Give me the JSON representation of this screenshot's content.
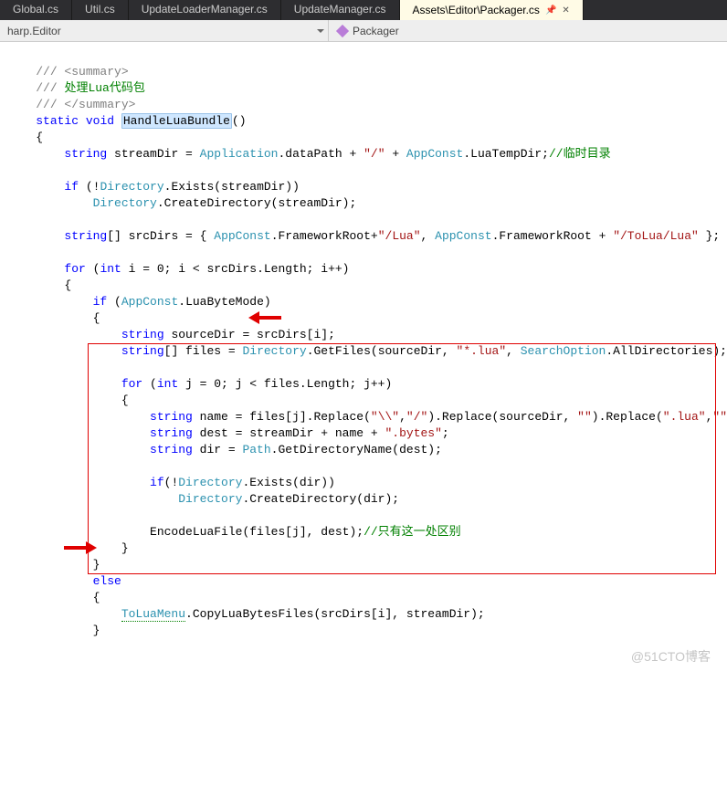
{
  "tabs": {
    "t0": "Global.cs",
    "t1": "Util.cs",
    "t2": "UpdateLoaderManager.cs",
    "t3": "UpdateManager.cs",
    "t4": "Assets\\Editor\\Packager.cs"
  },
  "nav": {
    "left": "harp.Editor",
    "right": "Packager"
  },
  "code": {
    "l1a": "/// <summary>",
    "l2a": "/// ",
    "l2b": "处理Lua代码包",
    "l3a": "/// </summary>",
    "l4a": "static",
    "l4b": "void",
    "l4c": "HandleLuaBundle",
    "l4d": "()",
    "l5a": "{",
    "l6a": "string",
    "l6b": " streamDir = ",
    "l6c": "Application",
    "l6d": ".dataPath + ",
    "l6e": "\"/\"",
    "l6f": " + ",
    "l6g": "AppConst",
    "l6h": ".LuaTempDir;",
    "l6i": "//临时目录",
    "l8a": "if",
    "l8b": " (!",
    "l8c": "Directory",
    "l8d": ".Exists(streamDir))",
    "l9a": "Directory",
    "l9b": ".CreateDirectory(streamDir);",
    "l11a": "string",
    "l11b": "[] srcDirs = { ",
    "l11c": "AppConst",
    "l11d": ".FrameworkRoot+",
    "l11e": "\"/Lua\"",
    "l11f": ", ",
    "l11g": "AppConst",
    "l11h": ".FrameworkRoot + ",
    "l11i": "\"/ToLua/Lua\"",
    "l11j": " };",
    "l13a": "for",
    "l13b": " (",
    "l13c": "int",
    "l13d": " i = 0; i < srcDirs.Length; i++)",
    "l14a": "{",
    "l15a": "if",
    "l15b": " (",
    "l15c": "AppConst",
    "l15d": ".LuaByteMode)",
    "l16a": "{",
    "l17a": "string",
    "l17b": " sourceDir = srcDirs[i];",
    "l18a": "string",
    "l18b": "[] files = ",
    "l18c": "Directory",
    "l18d": ".GetFiles(sourceDir, ",
    "l18e": "\"*.lua\"",
    "l18f": ", ",
    "l18g": "SearchOption",
    "l18h": ".AllDirectories);",
    "l20a": "for",
    "l20b": " (",
    "l20c": "int",
    "l20d": " j = 0; j < files.Length; j++)",
    "l21a": "{",
    "l22a": "string",
    "l22b": " name = files[j].Replace(",
    "l22c": "\"\\\\\"",
    "l22d": ",",
    "l22e": "\"/\"",
    "l22f": ").Replace(sourceDir, ",
    "l22g": "\"\"",
    "l22h": ").Replace(",
    "l22i": "\".lua\"",
    "l22j": ",",
    "l22k": "\"\"",
    "l22l": ");",
    "l23a": "string",
    "l23b": " dest = streamDir + name + ",
    "l23c": "\".bytes\"",
    "l23d": ";",
    "l24a": "string",
    "l24b": " dir = ",
    "l24c": "Path",
    "l24d": ".GetDirectoryName(dest);",
    "l26a": "if",
    "l26b": "(!",
    "l26c": "Directory",
    "l26d": ".Exists(dir))",
    "l27a": "Directory",
    "l27b": ".CreateDirectory(dir);",
    "l29a": "EncodeLuaFile(files[j], dest);",
    "l29b": "//只有这一处区别",
    "l30a": "}",
    "l31a": "}",
    "l32a": "else",
    "l33a": "{",
    "l34a": "ToLuaMenu",
    "l34b": ".CopyLuaBytesFiles(srcDirs[i], streamDir);",
    "l35a": "}"
  },
  "watermark": "@51CTO博客"
}
